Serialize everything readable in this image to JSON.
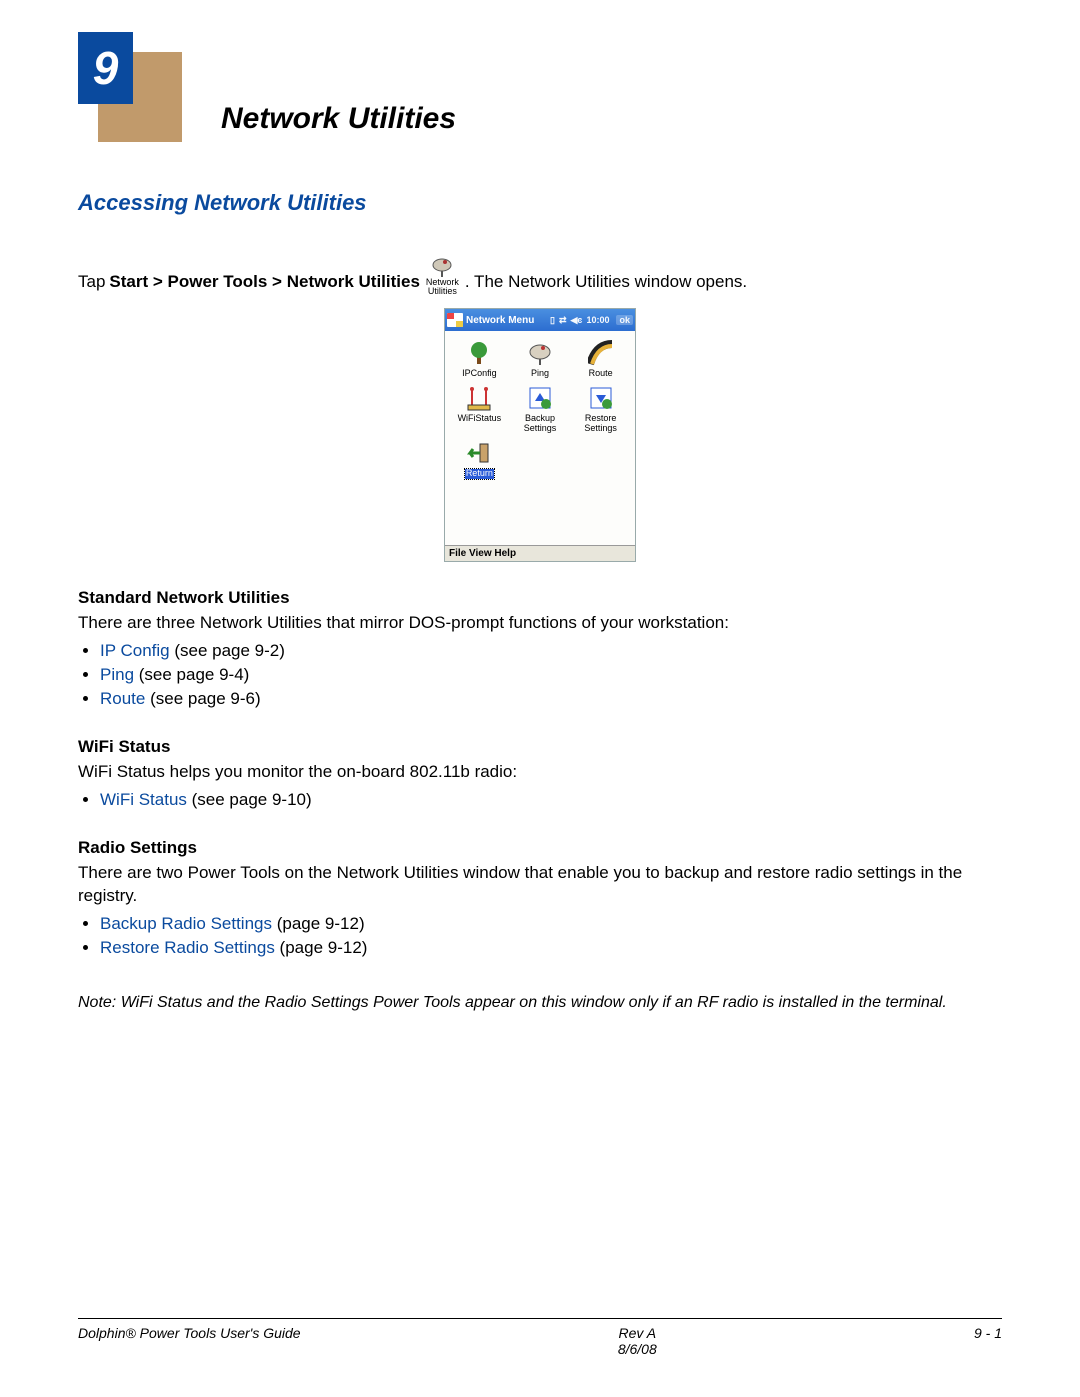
{
  "chapter": {
    "number": "9",
    "title": "Network Utilities"
  },
  "section": {
    "heading": "Accessing Network Utilities"
  },
  "intro": {
    "prefix": "Tap ",
    "path": "Start > Power Tools > Network Utilities",
    "icon_top": "Network",
    "icon_bottom": "Utilities",
    "suffix": ". The Network Utilities window opens."
  },
  "screenshot": {
    "title": "Network Menu",
    "time": "10:00",
    "ok": "ok",
    "items": [
      {
        "label": "IPConfig"
      },
      {
        "label": "Ping"
      },
      {
        "label": "Route"
      },
      {
        "label": "WiFiStatus"
      },
      {
        "label": "Backup\nSettings"
      },
      {
        "label": "Restore\nSettings"
      },
      {
        "label": "Return",
        "selected": true
      }
    ],
    "menubar": "File View Help"
  },
  "standard": {
    "heading": "Standard Network Utilities",
    "text": "There are three Network Utilities that mirror DOS-prompt functions of your workstation:",
    "items": [
      {
        "link": "IP Config",
        "rest": " (see page 9-2)"
      },
      {
        "link": "Ping",
        "rest": " (see page 9-4)"
      },
      {
        "link": "Route",
        "rest": " (see page 9-6)"
      }
    ]
  },
  "wifi": {
    "heading": "WiFi Status",
    "text": "WiFi Status helps you monitor the on-board 802.11b radio:",
    "items": [
      {
        "link": "WiFi Status",
        "rest": " (see page 9-10)"
      }
    ]
  },
  "radio": {
    "heading": "Radio Settings",
    "text": "There are two Power Tools on the Network Utilities window that enable you to backup and restore radio settings in the registry.",
    "items": [
      {
        "link": "Backup Radio Settings",
        "rest": " (page 9-12)"
      },
      {
        "link": "Restore Radio Settings",
        "rest": " (page 9-12)"
      }
    ]
  },
  "note": {
    "label": "Note:",
    "text": " WiFi Status and the Radio Settings Power Tools appear on this window only if an RF radio is installed in the terminal."
  },
  "footer": {
    "left": "Dolphin® Power Tools User's Guide",
    "center_top": "Rev A",
    "center_bottom": "8/6/08",
    "right": "9 - 1"
  }
}
